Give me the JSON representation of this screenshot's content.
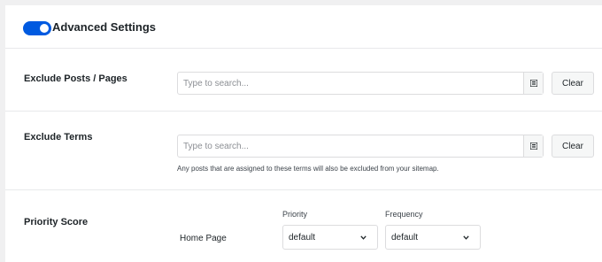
{
  "header": {
    "toggle_on": true,
    "title": "Advanced Settings"
  },
  "exclude_posts": {
    "label": "Exclude Posts / Pages",
    "placeholder": "Type to search...",
    "clear_label": "Clear"
  },
  "exclude_terms": {
    "label": "Exclude Terms",
    "placeholder": "Type to search...",
    "clear_label": "Clear",
    "help_text": "Any posts that are assigned to these terms will also be excluded from your sitemap."
  },
  "priority_score": {
    "label": "Priority Score",
    "priority_header": "Priority",
    "frequency_header": "Frequency",
    "rows": [
      {
        "label": "Home Page",
        "priority": "default",
        "frequency": "default"
      }
    ]
  },
  "colors": {
    "accent": "#005ae0",
    "background": "#f0f0f1",
    "panel": "#ffffff",
    "border": "#dcdcde"
  },
  "icons": {
    "picker": "grid-list-icon",
    "dropdown": "chevron-down-icon"
  }
}
